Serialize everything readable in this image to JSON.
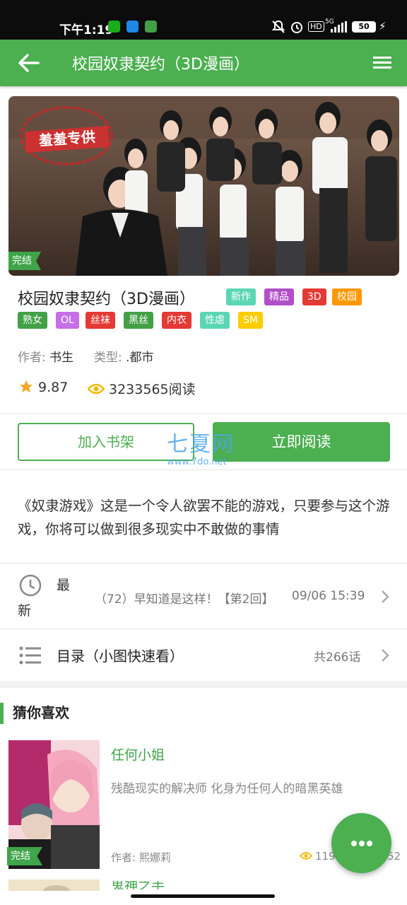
{
  "status_bar": {
    "time": "下午1:19",
    "hd": "HD",
    "network": "5G",
    "battery": "50"
  },
  "header": {
    "title": "校园奴隶契约（3D漫画）"
  },
  "book": {
    "cover_stamp": "羞羞专供",
    "status_label": "完结",
    "title": "校园奴隶契约（3D漫画）",
    "tags": [
      {
        "text": "新作",
        "color": "#5bd6b5"
      },
      {
        "text": "精品",
        "color": "#b14fc8"
      },
      {
        "text": "3D",
        "color": "#e53935"
      },
      {
        "text": "校园",
        "color": "#ff9800"
      },
      {
        "text": "熟女",
        "color": "#43a047"
      },
      {
        "text": "OL",
        "color": "#c66fe6"
      },
      {
        "text": "丝袜",
        "color": "#e53935"
      },
      {
        "text": "黑丝",
        "color": "#43a047"
      },
      {
        "text": "内衣",
        "color": "#e53935"
      },
      {
        "text": "性虐",
        "color": "#5bd6b5"
      },
      {
        "text": "SM",
        "color": "#ffcc00"
      }
    ],
    "author_label": "作者:",
    "author": "书生",
    "genre_label": "类型:",
    "genre": ".都市",
    "rating": "9.87",
    "views": "3233565阅读"
  },
  "actions": {
    "add_shelf": "加入书架",
    "read_now": "立即阅读"
  },
  "watermark": {
    "name": "七夏网",
    "url": "www.7do.net"
  },
  "description": "《奴隶游戏》这是一个令人欲罢不能的游戏，只要参与这个游戏，你将可以做到很多现实中不敢做的事情",
  "latest": {
    "label_line1": "最",
    "label_line2": "新",
    "chapter": "（72）早知道是这样！【第2回】",
    "date": "09/06 15:39"
  },
  "toc": {
    "label": "目录（小图快速看）",
    "count": "共266话"
  },
  "recommend": {
    "section_title": "猜你喜欢",
    "items": [
      {
        "title": "任何小姐",
        "desc": "残酷现实的解决师 化身为任何人的暗黑英雄",
        "author_label": "作者:",
        "author": "熙娜莉",
        "views_start": "119",
        "views_end": "52",
        "status_label": "完结"
      },
      {
        "title": "鬼神之手"
      }
    ]
  },
  "colors": {
    "brand": "#4caf50",
    "star": "#f5a623",
    "eye": "#f5b800"
  }
}
